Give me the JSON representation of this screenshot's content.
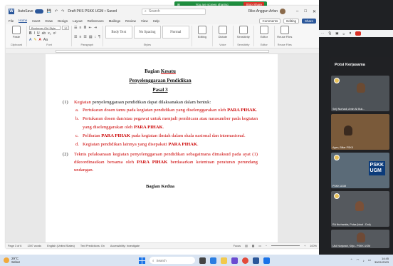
{
  "meet_banner": {
    "text": "You are screen sharing",
    "stop_label": "Stop Share"
  },
  "word": {
    "title": "Draft PKS PSKK UGM • Saved",
    "autosave_label": "AutoSave",
    "search_placeholder": "Search",
    "user_name": "Riko Anggun Arfan",
    "menu": [
      "File",
      "Home",
      "Insert",
      "Draw",
      "Design",
      "Layout",
      "References",
      "Mailings",
      "Review",
      "View",
      "Help"
    ],
    "active_menu": "Home",
    "comments_label": "Comments",
    "editing_label": "Editing",
    "share_label": "Share",
    "ribbon": {
      "font_name": "Bookman Old Style",
      "font_size": "12",
      "groups": [
        "Clipboard",
        "Font",
        "Paragraph",
        "Styles",
        "Voice",
        "Sensitivity",
        "Editor",
        "Reuse Files"
      ],
      "styles": [
        "Body Text",
        "No Spacing",
        "Normal"
      ],
      "buttons": [
        "Paste",
        "Editing",
        "Dictate",
        "Sensitivity",
        "Editor",
        "Reuse Files"
      ]
    },
    "status": {
      "page": "Page 3 of 6",
      "words": "1397 words",
      "language": "English (United States)",
      "predictions": "Text Predictions: On",
      "accessibility": "Accessibility: Investigate",
      "focus": "Focus",
      "zoom": "100%"
    }
  },
  "document": {
    "heading1": "Bagian",
    "heading1_red": "Kesatu",
    "heading2": "Penyelenggaraan Pendidikan",
    "heading3": "Pasal 3",
    "p1_num": "(1)",
    "p1_red": "Kegiatan",
    "p1_text": "penyelenggaraan pendidikan dapat dilaksanakan dalam bentuk:",
    "items": [
      {
        "letter": "a.",
        "text": "Pertukaran dosen tamu pada kegiatan pendidikan yang diselenggarakan oleh ",
        "bold": "PARA PIHAK",
        "tail": ".",
        "red": true
      },
      {
        "letter": "b.",
        "text": "Pertukaran dosen dan/atau pegawai untuk menjadi pembicara atau narasumber pada kegiatan yang diselenggarakan oleh ",
        "bold": "PARA PIHAK",
        "tail": ".",
        "red": true
      },
      {
        "letter": "c.",
        "text": "Pelibatan ",
        "bold": "PARA PIHAK",
        "tail": " pada kegiatan ilmiah dalam skala nasional dan internasional.",
        "red": true
      },
      {
        "letter": "d.",
        "text": "Kegiatan pendidikan lainnya yang disepakati ",
        "bold": "PARA PIHAK",
        "tail": ".",
        "red": true
      }
    ],
    "p2_num": "(2)",
    "p2_text": "Teknis pelaksanaan kegiatan penyelenggaraan pendidikan sebagaimana dimaksud pada ayat (1) dikoordinasikan bersama oleh ",
    "p2_bold": "PARA PIHAK",
    "p2_tail": " berdasarkan ketentuan peraturan perundang undangan.",
    "heading_next": "Bagian Kedua"
  },
  "meet": {
    "panel_title": "Potsi Kerjasama",
    "subtitle": "Potsi Kerjasama",
    "tiles": [
      {
        "name": "Seiji Nurhadi, Amin Ali Buk..."
      },
      {
        "name": "Agen, Blitar PSKK"
      },
      {
        "name": "PSKK UGM",
        "banner": "PSKK\nUGM"
      },
      {
        "name": "RA Nurhanida, Pulsa (lokal - Dok)"
      },
      {
        "name": "Ulul Nurjanah, Kirju - PSKK UGM"
      }
    ]
  },
  "taskbar": {
    "weather_temp": "29°C",
    "weather_desc": "Sebut",
    "search_placeholder": "Search",
    "time": "14:45",
    "date": "30/01/2023"
  }
}
